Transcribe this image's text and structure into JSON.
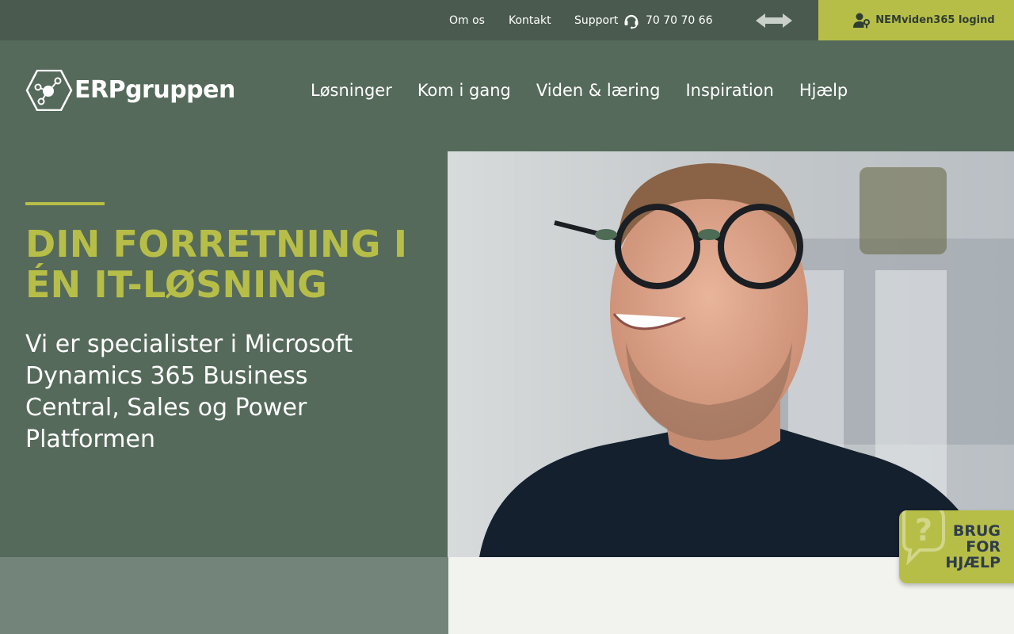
{
  "topbar": {
    "links": [
      "Om os",
      "Kontakt",
      "Support"
    ],
    "phone": "70 70 70 66",
    "login_label": "NEMviden365 logind"
  },
  "header": {
    "logo_text": "ERPgruppen",
    "nav": [
      "Løsninger",
      "Kom i gang",
      "Viden & læring",
      "Inspiration",
      "Hjælp"
    ]
  },
  "hero": {
    "title": "DIN FORRETNING I ÉN IT-LØSNING",
    "subtitle": "Vi er specialister i Microsoft Dynamics 365 Business Central, Sales og Power Platformen"
  },
  "help_widget": {
    "line1": "BRUG",
    "line2": "FOR",
    "line3": "HJÆLP"
  },
  "colors": {
    "accent": "#b7be48",
    "header_bg": "#556a5b",
    "topbar_bg": "#4a5a4e"
  },
  "icons": {
    "support": "headset-icon",
    "language": "arrows-icon",
    "login": "user-key-icon",
    "help": "question-bubble-icon"
  }
}
